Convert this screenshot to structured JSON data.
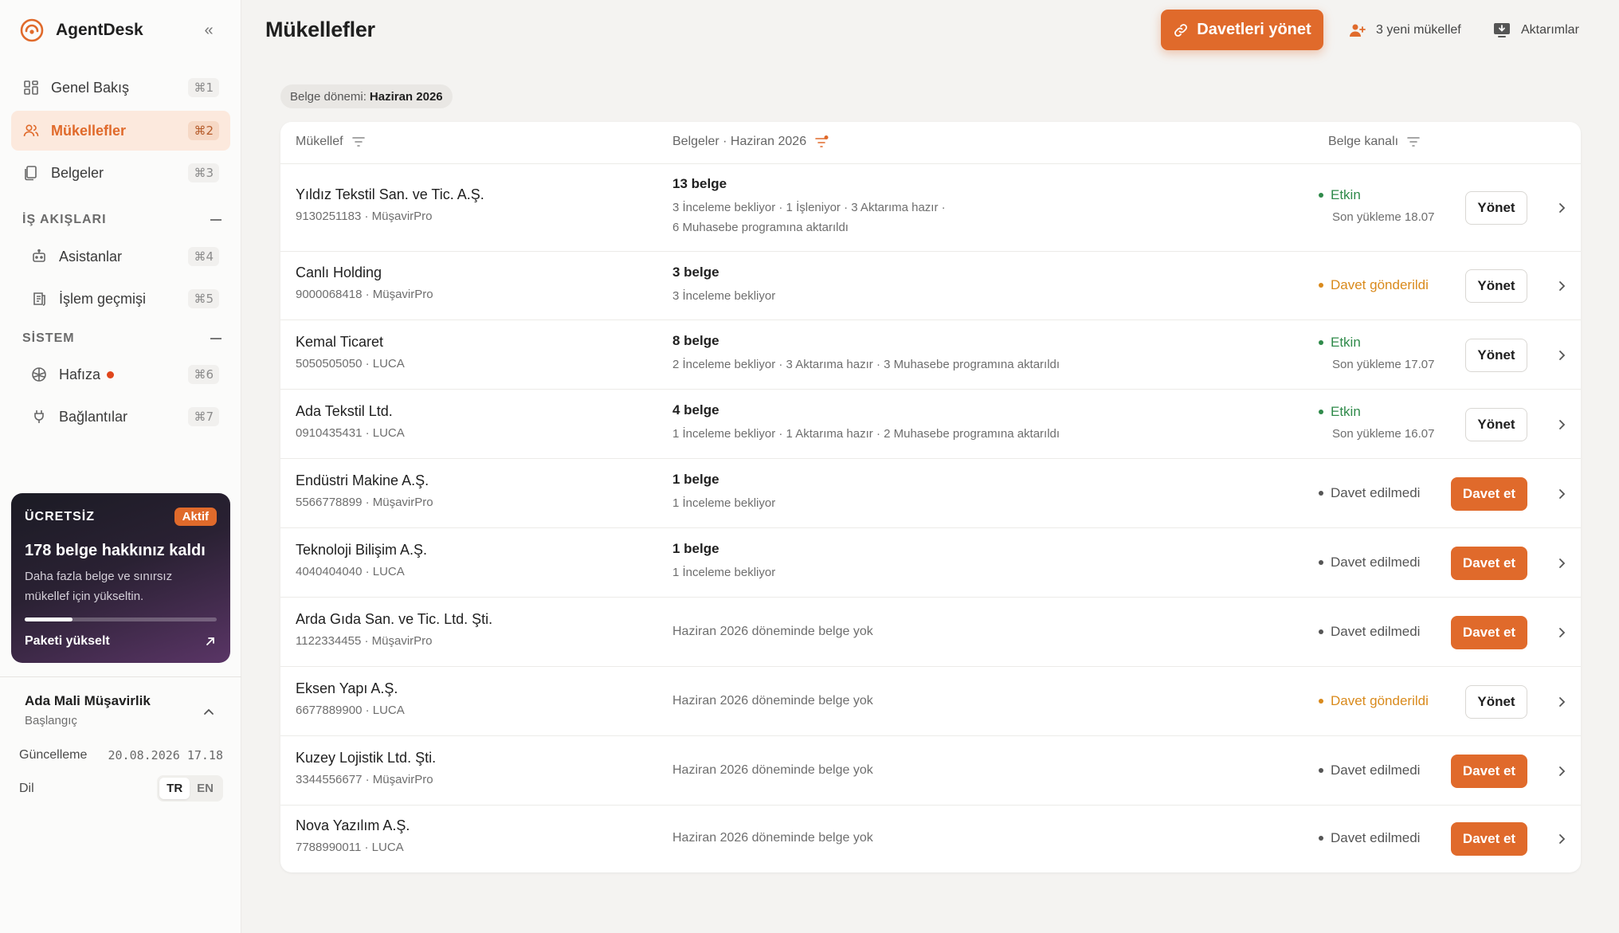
{
  "brand": {
    "name": "AgentDesk",
    "accent": "#e06a2b"
  },
  "nav": {
    "main": [
      {
        "label": "Genel Bakış",
        "kbd": "⌘1",
        "icon": "dashboard-icon"
      },
      {
        "label": "Mükellefler",
        "kbd": "⌘2",
        "icon": "users-icon",
        "active": true
      },
      {
        "label": "Belgeler",
        "kbd": "⌘3",
        "icon": "documents-icon"
      }
    ],
    "workflows_title": "İŞ AKIŞLARI",
    "workflows": [
      {
        "label": "Asistanlar",
        "kbd": "⌘4",
        "icon": "robot-icon"
      },
      {
        "label": "İşlem geçmişi",
        "kbd": "⌘5",
        "icon": "history-icon"
      }
    ],
    "system_title": "SİSTEM",
    "system": [
      {
        "label": "Hafıza",
        "kbd": "⌘6",
        "icon": "brain-icon",
        "has_dot": true
      },
      {
        "label": "Bağlantılar",
        "kbd": "⌘7",
        "icon": "plug-icon"
      }
    ]
  },
  "promo": {
    "tier": "ÜCRETSİZ",
    "badge": "Aktif",
    "title": "178 belge hakkınız kaldı",
    "desc": "Daha fazla belge ve sınırsız mükellef için yükseltin.",
    "usage_fraction": 0.25,
    "cta": "Paketi yükselt"
  },
  "org": {
    "name": "Ada Mali Müşavirlik",
    "plan": "Başlangıç",
    "update_label": "Güncelleme",
    "update_value": "20.08.2026 17.18",
    "lang_label": "Dil",
    "lang_options": [
      "TR",
      "EN"
    ],
    "lang_selected": "TR"
  },
  "header": {
    "title": "Mükellefler",
    "primary_cta": "Davetleri yönet",
    "new_clients": "3 yeni mükellef",
    "transfers": "Aktarımlar"
  },
  "period": {
    "label": "Belge dönemi:",
    "value": "Haziran 2026"
  },
  "table": {
    "columns": {
      "client": "Mükellef",
      "documents": "Belgeler · Haziran 2026",
      "channel": "Belge kanalı"
    },
    "manage_label": "Yönet",
    "invite_label": "Davet et",
    "rows": [
      {
        "name": "Yıldız Tekstil San. ve Tic. A.Ş.",
        "sub": "9130251183 · MüşavirPro",
        "count": "13 belge",
        "statuses": [
          "3 İnceleme bekliyor · 1 İşleniyor · 3 Aktarıma hazır ·",
          "6 Muhasebe programına aktarıldı"
        ],
        "status": "Etkin",
        "status_kind": "active",
        "last": "Son yükleme 18.07",
        "action": "manage"
      },
      {
        "name": "Canlı Holding",
        "sub": "9000068418 · MüşavirPro",
        "count": "3 belge",
        "statuses": [
          "3 İnceleme bekliyor"
        ],
        "status": "Davet gönderildi",
        "status_kind": "sent",
        "last": "",
        "action": "manage"
      },
      {
        "name": "Kemal Ticaret",
        "sub": "5050505050 · LUCA",
        "count": "8 belge",
        "statuses": [
          "2 İnceleme bekliyor · 3 Aktarıma hazır · 3 Muhasebe programına aktarıldı"
        ],
        "status": "Etkin",
        "status_kind": "active",
        "last": "Son yükleme 17.07",
        "action": "manage"
      },
      {
        "name": "Ada Tekstil Ltd.",
        "sub": "0910435431 · LUCA",
        "count": "4 belge",
        "statuses": [
          "1 İnceleme bekliyor · 1 Aktarıma hazır · 2 Muhasebe programına aktarıldı"
        ],
        "status": "Etkin",
        "status_kind": "active",
        "last": "Son yükleme 16.07",
        "action": "manage"
      },
      {
        "name": "Endüstri Makine A.Ş.",
        "sub": "5566778899 · MüşavirPro",
        "count": "1 belge",
        "statuses": [
          "1 İnceleme bekliyor"
        ],
        "status": "Davet edilmedi",
        "status_kind": "none",
        "last": "",
        "action": "invite"
      },
      {
        "name": "Teknoloji Bilişim A.Ş.",
        "sub": "4040404040 · LUCA",
        "count": "1 belge",
        "statuses": [
          "1 İnceleme bekliyor"
        ],
        "status": "Davet edilmedi",
        "status_kind": "none",
        "last": "",
        "action": "invite"
      },
      {
        "name": "Arda Gıda San. ve Tic. Ltd. Şti.",
        "sub": "1122334455 · MüşavirPro",
        "count": "",
        "empty": "Haziran 2026 döneminde belge yok",
        "statuses": [],
        "status": "Davet edilmedi",
        "status_kind": "none",
        "last": "",
        "action": "invite"
      },
      {
        "name": "Eksen Yapı A.Ş.",
        "sub": "6677889900 · LUCA",
        "count": "",
        "empty": "Haziran 2026 döneminde belge yok",
        "statuses": [],
        "status": "Davet gönderildi",
        "status_kind": "sent",
        "last": "",
        "action": "manage"
      },
      {
        "name": "Kuzey Lojistik Ltd. Şti.",
        "sub": "3344556677 · MüşavirPro",
        "count": "",
        "empty": "Haziran 2026 döneminde belge yok",
        "statuses": [],
        "status": "Davet edilmedi",
        "status_kind": "none",
        "last": "",
        "action": "invite"
      },
      {
        "name": "Nova Yazılım A.Ş.",
        "sub": "7788990011 · LUCA",
        "count": "",
        "empty": "Haziran 2026 döneminde belge yok",
        "statuses": [],
        "status": "Davet edilmedi",
        "status_kind": "none",
        "last": "",
        "action": "invite"
      }
    ]
  },
  "colors": {
    "active": "#2f8a4a",
    "sent": "#d98a1c",
    "none": "#555555",
    "primary": "#e06a2b"
  }
}
